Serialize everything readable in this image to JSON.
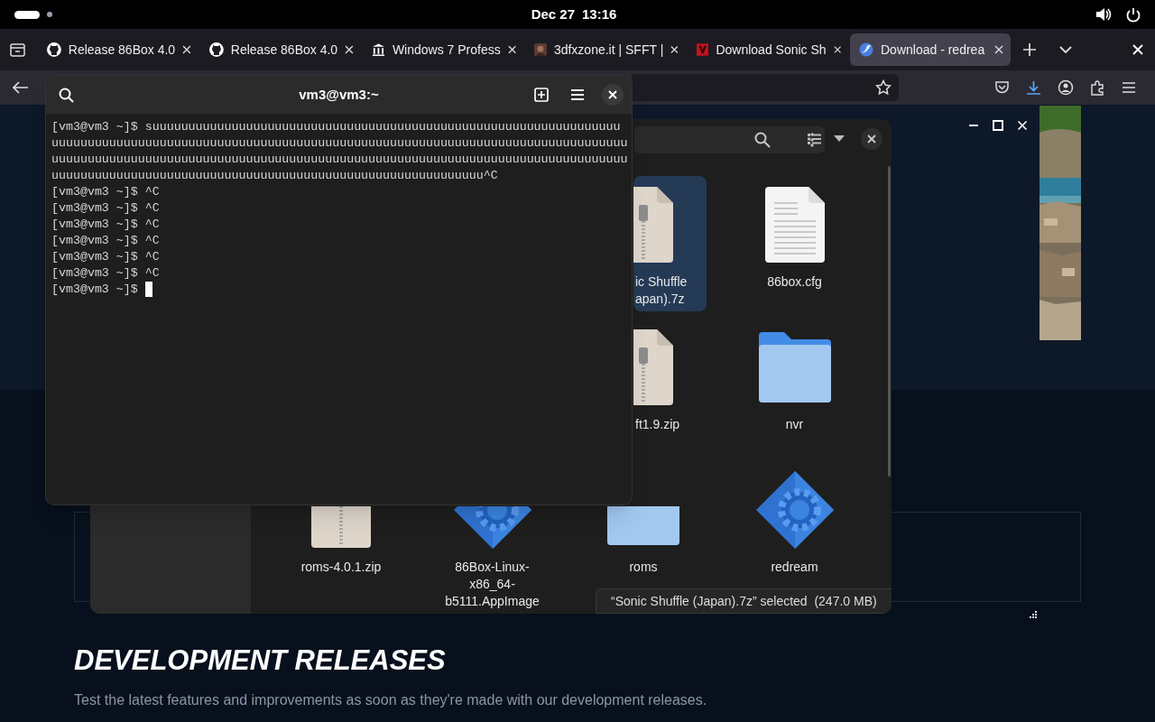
{
  "top_bar": {
    "date": "Dec 27",
    "time": "13:16"
  },
  "browser": {
    "tabs": [
      {
        "title": "Release 86Box 4.0",
        "selected": false
      },
      {
        "title": "Release 86Box 4.0",
        "selected": false
      },
      {
        "title": "Windows 7 Profess",
        "selected": false
      },
      {
        "title": "3dfxzone.it | SFFT |",
        "selected": false
      },
      {
        "title": "Download Sonic Sh",
        "selected": false
      },
      {
        "title": "Download - redrea",
        "selected": true
      }
    ]
  },
  "web_page": {
    "heading": "DEVELOPMENT RELEASES",
    "text": "Test the latest features and improvements as soon as they're made with our development releases."
  },
  "files_window": {
    "items": [
      {
        "kind": "archive",
        "lines": [
          "ic Shuffle",
          "apan).7z"
        ],
        "selected": true
      },
      {
        "kind": "document",
        "lines": [
          "86box.cfg"
        ],
        "selected": false
      },
      {
        "kind": "archive",
        "lines": [
          "ft1.9.zip"
        ],
        "selected": false
      },
      {
        "kind": "folder",
        "lines": [
          "nvr"
        ],
        "selected": false
      },
      {
        "kind": "archive",
        "lines": [
          "roms-4.0.1.zip"
        ],
        "selected": false
      },
      {
        "kind": "app",
        "lines": [
          "86Box-Linux-",
          "x86_64-",
          "b5111.AppImage"
        ],
        "selected": false
      },
      {
        "kind": "folder",
        "lines": [
          "roms"
        ],
        "selected": false
      },
      {
        "kind": "app",
        "lines": [
          "redream"
        ],
        "selected": false
      }
    ],
    "status": "“Sonic Shuffle (Japan).7z” selected  (247.0 MB)"
  },
  "terminal": {
    "title": "vm3@vm3:~",
    "lines": [
      "[vm3@vm3 ~]$ suuuuuuuuuuuuuuuuuuuuuuuuuuuuuuuuuuuuuuuuuuuuuuuuuuuuuuuuuuuuuuuuu",
      "uuuuuuuuuuuuuuuuuuuuuuuuuuuuuuuuuuuuuuuuuuuuuuuuuuuuuuuuuuuuuuuuuuuuuuuuuuuuuuuu",
      "uuuuuuuuuuuuuuuuuuuuuuuuuuuuuuuuuuuuuuuuuuuuuuuuuuuuuuuuuuuuuuuuuuuuuuuuuuuuuuuu",
      "uuuuuuuuuuuuuuuuuuuuuuuuuuuuuuuuuuuuuuuuuuuuuuuuuuuuuuuuuuuu^C",
      "[vm3@vm3 ~]$ ^C",
      "[vm3@vm3 ~]$ ^C",
      "[vm3@vm3 ~]$ ^C",
      "[vm3@vm3 ~]$ ^C",
      "[vm3@vm3 ~]$ ^C",
      "[vm3@vm3 ~]$ ^C",
      "[vm3@vm3 ~]$ "
    ],
    "cursor": true
  }
}
